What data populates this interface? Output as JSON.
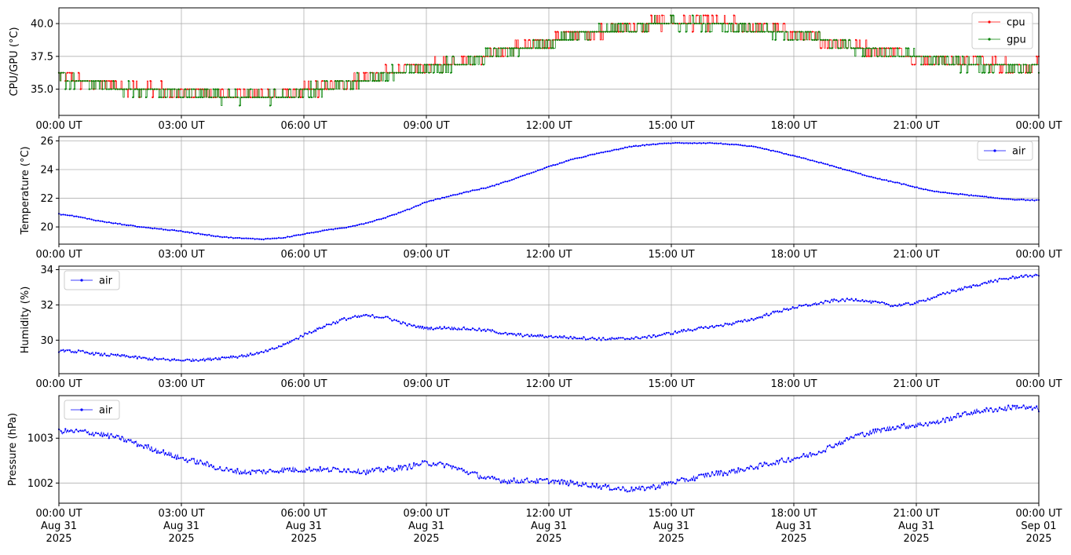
{
  "chart_data": [
    {
      "type": "line",
      "ylabel": "CPU/GPU (°C)",
      "xlim": [
        "00:00",
        "24:00"
      ],
      "ylim": [
        33,
        41.2
      ],
      "grid": true,
      "legend": "top-right",
      "x_ticks": [
        "00:00 UT",
        "03:00 UT",
        "06:00 UT",
        "09:00 UT",
        "12:00 UT",
        "15:00 UT",
        "18:00 UT",
        "21:00 UT",
        "00:00 UT"
      ],
      "y_ticks": [
        35.0,
        37.5,
        40.0
      ],
      "y_tick_labels": [
        "35.0",
        "37.5",
        "40.0"
      ],
      "series": [
        {
          "name": "cpu",
          "color": "#ff0000",
          "x_hours": [
            0,
            0.5,
            1,
            1.5,
            2,
            2.5,
            3,
            3.5,
            4,
            4.5,
            5,
            5.5,
            6,
            6.5,
            7,
            7.5,
            8,
            8.5,
            9,
            9.5,
            10,
            10.5,
            11,
            11.5,
            12,
            12.5,
            13,
            13.5,
            14,
            14.5,
            15,
            15.5,
            16,
            16.5,
            17,
            17.5,
            18,
            18.5,
            19,
            19.5,
            20,
            20.5,
            21,
            21.5,
            22,
            22.5,
            23,
            23.5,
            24
          ],
          "values": [
            35.9,
            35.6,
            35.4,
            35.2,
            35.0,
            34.9,
            34.8,
            34.7,
            34.6,
            34.5,
            34.5,
            34.6,
            34.9,
            35.2,
            35.5,
            35.8,
            36.2,
            36.5,
            36.7,
            37.0,
            37.3,
            37.6,
            38.0,
            38.4,
            38.7,
            39.0,
            39.3,
            39.6,
            39.8,
            40.0,
            40.1,
            40.1,
            40.0,
            39.9,
            39.7,
            39.5,
            39.2,
            38.9,
            38.6,
            38.3,
            38.0,
            37.8,
            37.5,
            37.3,
            37.1,
            37.0,
            36.9,
            36.8,
            36.8
          ]
        },
        {
          "name": "gpu",
          "color": "#008000",
          "x_hours": [
            0,
            0.5,
            1,
            1.5,
            2,
            2.5,
            3,
            3.5,
            4,
            4.5,
            5,
            5.5,
            6,
            6.5,
            7,
            7.5,
            8,
            8.5,
            9,
            9.5,
            10,
            10.5,
            11,
            11.5,
            12,
            12.5,
            13,
            13.5,
            14,
            14.5,
            15,
            15.5,
            16,
            16.5,
            17,
            17.5,
            18,
            18.5,
            19,
            19.5,
            20,
            20.5,
            21,
            21.5,
            22,
            22.5,
            23,
            23.5,
            24
          ],
          "values": [
            35.8,
            35.5,
            35.3,
            35.1,
            34.9,
            34.8,
            34.7,
            34.6,
            34.5,
            34.4,
            34.4,
            34.5,
            34.8,
            35.1,
            35.4,
            35.7,
            36.1,
            36.4,
            36.6,
            36.9,
            37.2,
            37.5,
            37.9,
            38.3,
            38.6,
            38.9,
            39.2,
            39.5,
            39.7,
            39.9,
            40.0,
            40.0,
            39.9,
            39.8,
            39.6,
            39.4,
            39.1,
            38.8,
            38.5,
            38.2,
            37.9,
            37.7,
            37.4,
            37.2,
            37.0,
            36.9,
            36.8,
            36.7,
            36.7
          ]
        }
      ]
    },
    {
      "type": "line",
      "ylabel": "Temperature (°C)",
      "xlim": [
        "00:00",
        "24:00"
      ],
      "ylim": [
        18.8,
        26.3
      ],
      "grid": true,
      "legend": "top-right",
      "x_ticks": [
        "00:00 UT",
        "03:00 UT",
        "06:00 UT",
        "09:00 UT",
        "12:00 UT",
        "15:00 UT",
        "18:00 UT",
        "21:00 UT",
        "00:00 UT"
      ],
      "y_ticks": [
        20,
        22,
        24,
        26
      ],
      "y_tick_labels": [
        "20",
        "22",
        "24",
        "26"
      ],
      "series": [
        {
          "name": "air",
          "color": "#0000ff",
          "x_hours": [
            0,
            0.5,
            1,
            1.5,
            2,
            2.5,
            3,
            3.5,
            4,
            4.5,
            5,
            5.5,
            6,
            6.5,
            7,
            7.5,
            8,
            8.5,
            9,
            9.5,
            10,
            10.5,
            11,
            11.5,
            12,
            12.5,
            13,
            13.5,
            14,
            14.5,
            15,
            15.5,
            16,
            16.5,
            17,
            17.5,
            18,
            18.5,
            19,
            19.5,
            20,
            20.5,
            21,
            21.5,
            22,
            22.5,
            23,
            23.5,
            24
          ],
          "values": [
            20.9,
            20.7,
            20.4,
            20.2,
            20.0,
            19.85,
            19.7,
            19.5,
            19.3,
            19.2,
            19.15,
            19.25,
            19.5,
            19.75,
            19.95,
            20.25,
            20.65,
            21.15,
            21.75,
            22.1,
            22.45,
            22.75,
            23.2,
            23.7,
            24.2,
            24.65,
            25.0,
            25.3,
            25.6,
            25.75,
            25.85,
            25.85,
            25.85,
            25.75,
            25.6,
            25.3,
            24.95,
            24.6,
            24.2,
            23.8,
            23.4,
            23.1,
            22.75,
            22.45,
            22.3,
            22.15,
            22.0,
            21.9,
            21.85
          ]
        }
      ]
    },
    {
      "type": "line",
      "ylabel": "Humidity (%)",
      "xlim": [
        "00:00",
        "24:00"
      ],
      "ylim": [
        28.1,
        34.2
      ],
      "grid": true,
      "legend": "top-left",
      "x_ticks": [
        "00:00 UT",
        "03:00 UT",
        "06:00 UT",
        "09:00 UT",
        "12:00 UT",
        "15:00 UT",
        "18:00 UT",
        "21:00 UT",
        "00:00 UT"
      ],
      "y_ticks": [
        30,
        32,
        34
      ],
      "y_tick_labels": [
        "30",
        "32",
        "34"
      ],
      "series": [
        {
          "name": "air",
          "color": "#0000ff",
          "x_hours": [
            0,
            0.5,
            1,
            1.5,
            2,
            2.5,
            3,
            3.5,
            4,
            4.5,
            5,
            5.5,
            6,
            6.5,
            7,
            7.5,
            8,
            8.5,
            9,
            9.5,
            10,
            10.5,
            11,
            11.5,
            12,
            12.5,
            13,
            13.5,
            14,
            14.5,
            15,
            15.5,
            16,
            16.5,
            17,
            17.5,
            18,
            18.5,
            19,
            19.5,
            20,
            20.5,
            21,
            21.5,
            22,
            22.5,
            23,
            23.5,
            24
          ],
          "values": [
            29.4,
            29.35,
            29.2,
            29.1,
            29.0,
            28.9,
            28.85,
            28.9,
            29.0,
            29.1,
            29.3,
            29.7,
            30.3,
            30.8,
            31.2,
            31.4,
            31.3,
            30.9,
            30.65,
            30.7,
            30.65,
            30.55,
            30.35,
            30.25,
            30.2,
            30.15,
            30.1,
            30.05,
            30.1,
            30.2,
            30.4,
            30.6,
            30.75,
            30.95,
            31.2,
            31.55,
            31.85,
            32.05,
            32.25,
            32.3,
            32.15,
            31.95,
            32.1,
            32.5,
            32.85,
            33.15,
            33.4,
            33.6,
            33.7
          ]
        }
      ]
    },
    {
      "type": "line",
      "ylabel": "Pressure (hPa)",
      "xlim": [
        "00:00",
        "24:00"
      ],
      "ylim": [
        1001.55,
        1003.95
      ],
      "grid": true,
      "legend": "top-left",
      "x_ticks": [
        "00:00 UT\nAug 31\n2025",
        "03:00 UT\nAug 31\n2025",
        "06:00 UT\nAug 31\n2025",
        "09:00 UT\nAug 31\n2025",
        "12:00 UT\nAug 31\n2025",
        "15:00 UT\nAug 31\n2025",
        "18:00 UT\nAug 31\n2025",
        "21:00 UT\nAug 31\n2025",
        "00:00 UT\nSep 01\n2025"
      ],
      "y_ticks": [
        1002,
        1003
      ],
      "y_tick_labels": [
        "1002",
        "1003"
      ],
      "series": [
        {
          "name": "air",
          "color": "#0000ff",
          "x_hours": [
            0,
            0.5,
            1,
            1.5,
            2,
            2.5,
            3,
            3.5,
            4,
            4.5,
            5,
            5.5,
            6,
            6.5,
            7,
            7.5,
            8,
            8.5,
            9,
            9.5,
            10,
            10.5,
            11,
            11.5,
            12,
            12.5,
            13,
            13.5,
            14,
            14.5,
            15,
            15.5,
            16,
            16.5,
            17,
            17.5,
            18,
            18.5,
            19,
            19.5,
            20,
            20.5,
            21,
            21.5,
            22,
            22.5,
            23,
            23.5,
            24
          ],
          "values": [
            1003.15,
            1003.15,
            1003.1,
            1003.0,
            1002.85,
            1002.7,
            1002.55,
            1002.45,
            1002.3,
            1002.25,
            1002.25,
            1002.3,
            1002.3,
            1002.3,
            1002.3,
            1002.25,
            1002.3,
            1002.35,
            1002.45,
            1002.4,
            1002.25,
            1002.1,
            1002.05,
            1002.05,
            1002.05,
            1002.0,
            1001.95,
            1001.9,
            1001.85,
            1001.9,
            1002.0,
            1002.1,
            1002.2,
            1002.25,
            1002.35,
            1002.45,
            1002.55,
            1002.65,
            1002.85,
            1003.05,
            1003.15,
            1003.25,
            1003.3,
            1003.35,
            1003.5,
            1003.6,
            1003.65,
            1003.7,
            1003.65
          ]
        }
      ]
    }
  ]
}
